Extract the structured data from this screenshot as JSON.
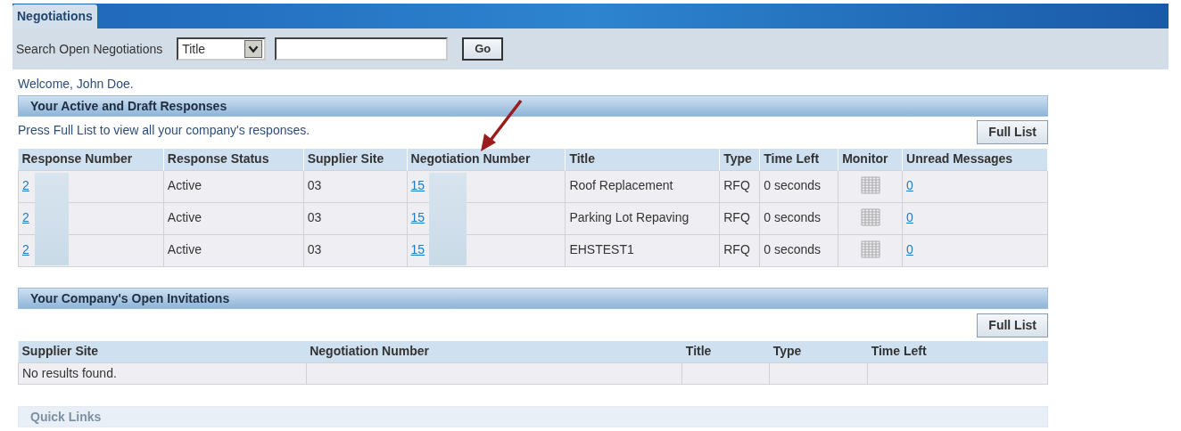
{
  "tabs": [
    {
      "label": "Negotiations",
      "selected": true
    }
  ],
  "search": {
    "label": "Search Open Negotiations",
    "field_option": "Title",
    "button": "Go"
  },
  "welcome": "Welcome, John Doe.",
  "responses": {
    "title": "Your Active and Draft Responses",
    "hint": "Press Full List to view all your company's responses.",
    "button": "Full List",
    "columns": [
      "Response Number",
      "Response Status",
      "Supplier Site",
      "Negotiation Number",
      "Title",
      "Type",
      "Time Left",
      "Monitor",
      "Unread Messages"
    ],
    "rows": [
      {
        "response_number": "2",
        "status": "Active",
        "supplier_site": "03",
        "negotiation_number": "15",
        "title": "Roof Replacement",
        "type": "RFQ",
        "time_left": "0 seconds",
        "unread": "0"
      },
      {
        "response_number": "2",
        "status": "Active",
        "supplier_site": "03",
        "negotiation_number": "15",
        "title": "Parking Lot Repaving",
        "type": "RFQ",
        "time_left": "0 seconds",
        "unread": "0"
      },
      {
        "response_number": "2",
        "status": "Active",
        "supplier_site": "03",
        "negotiation_number": "15",
        "title": "EHSTEST1",
        "type": "RFQ",
        "time_left": "0 seconds",
        "unread": "0"
      }
    ]
  },
  "invitations": {
    "title": "Your Company's Open Invitations",
    "button": "Full List",
    "columns": [
      "Supplier Site",
      "Negotiation Number",
      "Title",
      "Type",
      "Time Left"
    ],
    "empty_message": "No results found."
  },
  "quick_links": {
    "title": "Quick Links"
  }
}
